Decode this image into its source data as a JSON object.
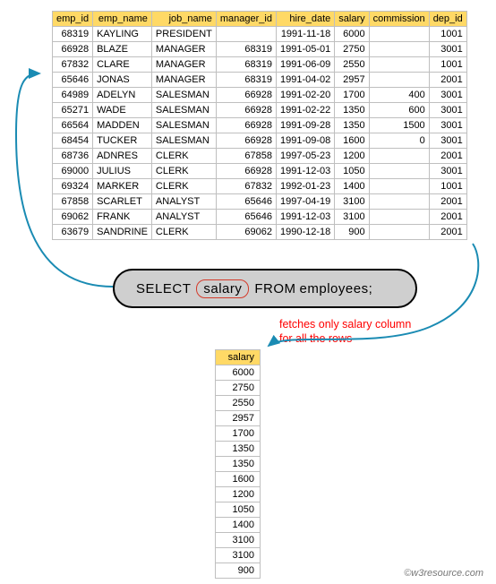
{
  "main_table": {
    "headers": [
      "emp_id",
      "emp_name",
      "job_name",
      "manager_id",
      "hire_date",
      "salary",
      "commission",
      "dep_id"
    ],
    "rows": [
      {
        "emp_id": "68319",
        "emp_name": "KAYLING",
        "job_name": "PRESIDENT",
        "manager_id": "",
        "hire_date": "1991-11-18",
        "salary": "6000",
        "commission": "",
        "dep_id": "1001"
      },
      {
        "emp_id": "66928",
        "emp_name": "BLAZE",
        "job_name": "MANAGER",
        "manager_id": "68319",
        "hire_date": "1991-05-01",
        "salary": "2750",
        "commission": "",
        "dep_id": "3001"
      },
      {
        "emp_id": "67832",
        "emp_name": "CLARE",
        "job_name": "MANAGER",
        "manager_id": "68319",
        "hire_date": "1991-06-09",
        "salary": "2550",
        "commission": "",
        "dep_id": "1001"
      },
      {
        "emp_id": "65646",
        "emp_name": "JONAS",
        "job_name": "MANAGER",
        "manager_id": "68319",
        "hire_date": "1991-04-02",
        "salary": "2957",
        "commission": "",
        "dep_id": "2001"
      },
      {
        "emp_id": "64989",
        "emp_name": "ADELYN",
        "job_name": "SALESMAN",
        "manager_id": "66928",
        "hire_date": "1991-02-20",
        "salary": "1700",
        "commission": "400",
        "dep_id": "3001"
      },
      {
        "emp_id": "65271",
        "emp_name": "WADE",
        "job_name": "SALESMAN",
        "manager_id": "66928",
        "hire_date": "1991-02-22",
        "salary": "1350",
        "commission": "600",
        "dep_id": "3001"
      },
      {
        "emp_id": "66564",
        "emp_name": "MADDEN",
        "job_name": "SALESMAN",
        "manager_id": "66928",
        "hire_date": "1991-09-28",
        "salary": "1350",
        "commission": "1500",
        "dep_id": "3001"
      },
      {
        "emp_id": "68454",
        "emp_name": "TUCKER",
        "job_name": "SALESMAN",
        "manager_id": "66928",
        "hire_date": "1991-09-08",
        "salary": "1600",
        "commission": "0",
        "dep_id": "3001"
      },
      {
        "emp_id": "68736",
        "emp_name": "ADNRES",
        "job_name": "CLERK",
        "manager_id": "67858",
        "hire_date": "1997-05-23",
        "salary": "1200",
        "commission": "",
        "dep_id": "2001"
      },
      {
        "emp_id": "69000",
        "emp_name": "JULIUS",
        "job_name": "CLERK",
        "manager_id": "66928",
        "hire_date": "1991-12-03",
        "salary": "1050",
        "commission": "",
        "dep_id": "3001"
      },
      {
        "emp_id": "69324",
        "emp_name": "MARKER",
        "job_name": "CLERK",
        "manager_id": "67832",
        "hire_date": "1992-01-23",
        "salary": "1400",
        "commission": "",
        "dep_id": "1001"
      },
      {
        "emp_id": "67858",
        "emp_name": "SCARLET",
        "job_name": "ANALYST",
        "manager_id": "65646",
        "hire_date": "1997-04-19",
        "salary": "3100",
        "commission": "",
        "dep_id": "2001"
      },
      {
        "emp_id": "69062",
        "emp_name": "FRANK",
        "job_name": "ANALYST",
        "manager_id": "65646",
        "hire_date": "1991-12-03",
        "salary": "3100",
        "commission": "",
        "dep_id": "2001"
      },
      {
        "emp_id": "63679",
        "emp_name": "SANDRINE",
        "job_name": "CLERK",
        "manager_id": "69062",
        "hire_date": "1990-12-18",
        "salary": "900",
        "commission": "",
        "dep_id": "2001"
      }
    ]
  },
  "sql": {
    "select": "SELECT",
    "column": "salary",
    "from": "FROM",
    "table": "employees;"
  },
  "annotation": {
    "line1": "fetches  only salary column",
    "line2": "for all the rows"
  },
  "result_table": {
    "header": "salary",
    "values": [
      "6000",
      "2750",
      "2550",
      "2957",
      "1700",
      "1350",
      "1350",
      "1600",
      "1200",
      "1050",
      "1400",
      "3100",
      "3100",
      "900"
    ]
  },
  "credit": "©w3resource.com"
}
